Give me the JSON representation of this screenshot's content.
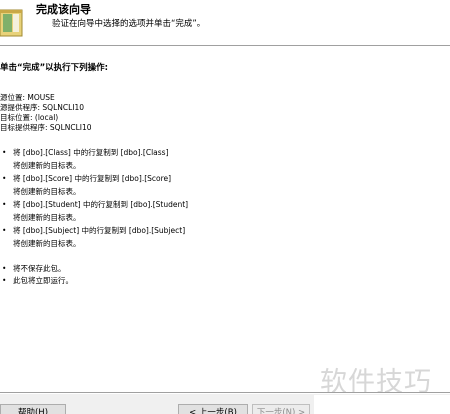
{
  "header": {
    "title": "完成该向导",
    "subtitle": "验证在向导中选择的选项并单击“完成”。"
  },
  "instruction": "单击“完成”以执行下列操作:",
  "summary": [
    "源位置: MOUSE",
    "源提供程序: SQLNCLI10",
    "目标位置: (local)",
    "目标提供程序: SQLNCLI10"
  ],
  "operations": [
    {
      "bullet": "•",
      "line1": "将 [dbo].[Class] 中的行复制到 [dbo].[Class]",
      "line2": "将创建新的目标表。"
    },
    {
      "bullet": "•",
      "line1": "将 [dbo].[Score] 中的行复制到 [dbo].[Score]",
      "line2": "将创建新的目标表。"
    },
    {
      "bullet": "•",
      "line1": "将 [dbo].[Student] 中的行复制到 [dbo].[Student]",
      "line2": "将创建新的目标表。"
    },
    {
      "bullet": "•",
      "line1": "将 [dbo].[Subject] 中的行复制到 [dbo].[Subject]",
      "line2": "将创建新的目标表。"
    }
  ],
  "notes": [
    {
      "bullet": "•",
      "text": "将不保存此包。"
    },
    {
      "bullet": "•",
      "text": "此包将立即运行。"
    }
  ],
  "watermark": "软件技巧",
  "buttons": {
    "help": "帮助(H)",
    "back": "< 上一步(B)",
    "next": "下一步(N) >"
  },
  "icons": {
    "wizard": "wizard-icon"
  }
}
